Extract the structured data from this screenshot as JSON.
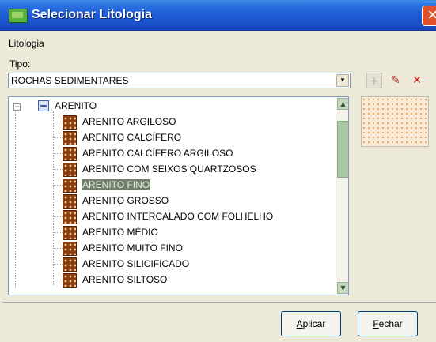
{
  "window": {
    "title": "Selecionar Litologia",
    "close_glyph": "✕"
  },
  "group_label": "Litologia",
  "tipo": {
    "label": "Tipo:",
    "value": "ROCHAS SEDIMENTARES",
    "dropdown_glyph": "▾"
  },
  "toolbar": {
    "add_icon": "plus-icon",
    "add_glyph": "+",
    "edit_icon": "pencil-icon",
    "edit_glyph": "✎",
    "delete_icon": "delete-icon",
    "delete_glyph": "✕"
  },
  "tree": {
    "expander_glyph": "−",
    "root_label": "ARENITO",
    "items": [
      {
        "label": "ARENITO ARGILOSO",
        "selected": false
      },
      {
        "label": "ARENITO CALCÍFERO",
        "selected": false
      },
      {
        "label": "ARENITO CALCÍFERO ARGILOSO",
        "selected": false
      },
      {
        "label": "ARENITO COM SEIXOS QUARTZOSOS",
        "selected": false
      },
      {
        "label": "ARENITO FINO",
        "selected": true
      },
      {
        "label": "ARENITO GROSSO",
        "selected": false
      },
      {
        "label": "ARENITO INTERCALADO COM FOLHELHO",
        "selected": false
      },
      {
        "label": "ARENITO MÉDIO",
        "selected": false
      },
      {
        "label": "ARENITO MUITO FINO",
        "selected": false
      },
      {
        "label": "ARENITO SILICIFICADO",
        "selected": false
      },
      {
        "label": "ARENITO SILTOSO",
        "selected": false
      }
    ],
    "scroll_up_glyph": "▲",
    "scroll_down_glyph": "▼"
  },
  "buttons": {
    "apply_mnemonic": "A",
    "apply_rest": "plicar",
    "close_mnemonic": "F",
    "close_rest": "echar"
  },
  "colors": {
    "title_bar": "#1d5bd6",
    "selection": "#6f7f6a",
    "pattern_bg": "#8a3b10"
  }
}
